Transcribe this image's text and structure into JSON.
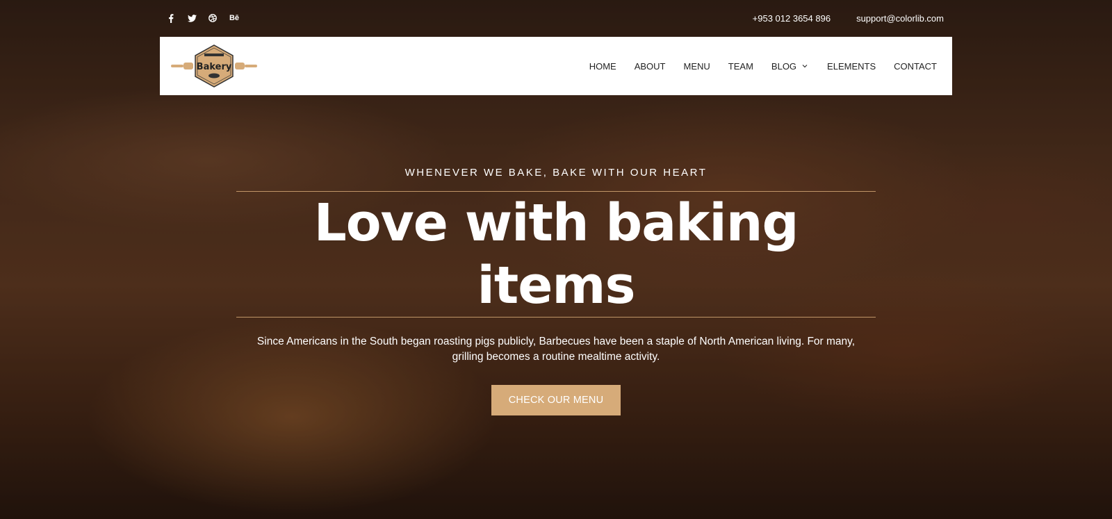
{
  "topbar": {
    "socials": [
      {
        "icon": "facebook-icon",
        "glyph": "f"
      },
      {
        "icon": "twitter-icon",
        "glyph": "🐦"
      },
      {
        "icon": "dribbble-icon",
        "glyph": "⊛"
      },
      {
        "icon": "behance-icon",
        "glyph": "Bē"
      }
    ],
    "phone": "+953 012 3654 896",
    "email": "support@colorlib.com"
  },
  "nav": {
    "logo_text": "Bakery",
    "items": [
      {
        "label": "HOME"
      },
      {
        "label": "ABOUT"
      },
      {
        "label": "MENU"
      },
      {
        "label": "TEAM"
      },
      {
        "label": "BLOG"
      },
      {
        "label": "ELEMENTS"
      },
      {
        "label": "CONTACT"
      }
    ]
  },
  "hero": {
    "tagline": "WHENEVER WE BAKE, BAKE WITH OUR HEART",
    "headline": "Love with baking items",
    "description": "Since Americans in the South began roasting pigs publicly, Barbecues have been a staple of North American living. For many, grilling becomes a routine mealtime activity.",
    "cta_label": "CHECK OUR MENU"
  },
  "colors": {
    "accent": "#d6ab79",
    "nav_bg": "#ffffff",
    "nav_text": "#222222"
  }
}
